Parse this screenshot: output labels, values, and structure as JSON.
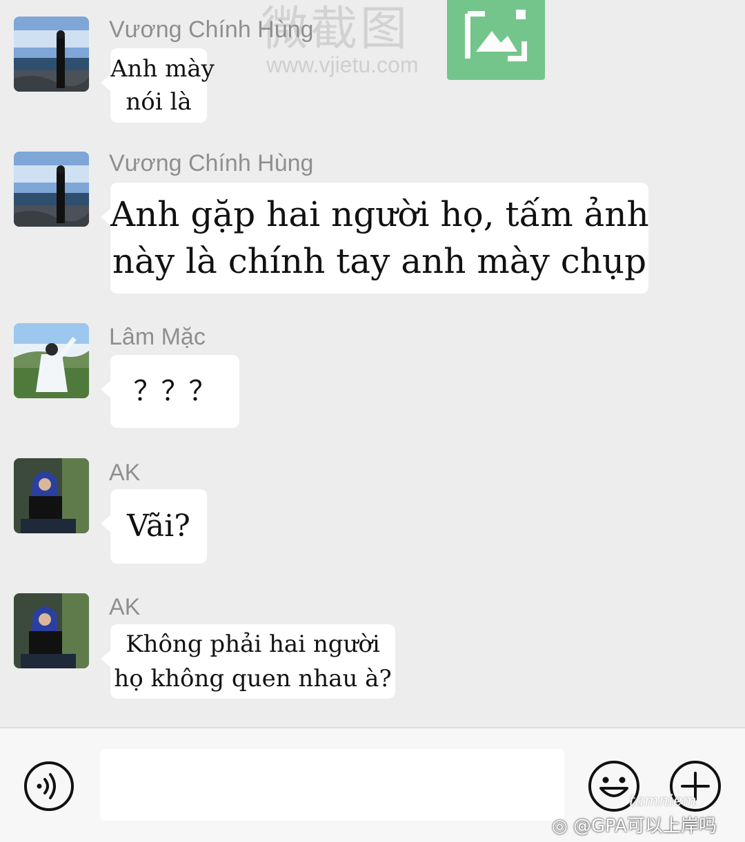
{
  "watermark": {
    "text": "微截图",
    "url": "www.vjietu.com"
  },
  "messages": [
    {
      "sender": "Vương Chính Hùng",
      "avatar": "beach-avatar",
      "lines": [
        "Anh mày",
        "nói là"
      ]
    },
    {
      "sender": "Vương Chính Hùng",
      "avatar": "beach-avatar",
      "lines": [
        "Anh gặp hai người họ, tấm ảnh",
        "này là chính tay anh mày chụp"
      ]
    },
    {
      "sender": "Lâm Mặc",
      "avatar": "field-avatar",
      "lines": [
        "？？？"
      ]
    },
    {
      "sender": "AK",
      "avatar": "hooded-avatar",
      "lines": [
        "Vãi?"
      ]
    },
    {
      "sender": "AK",
      "avatar": "hooded-avatar",
      "lines": [
        "Không phải hai người",
        "họ không quen nhau à?"
      ]
    }
  ],
  "input_bar": {
    "voice_icon": "voice-icon",
    "emoji_icon": "smiley-icon",
    "plus_icon": "plus-icon",
    "placeholder": ""
  },
  "overlay": {
    "credit": "@GPA可以上岸吗",
    "signature": "tamniem"
  }
}
